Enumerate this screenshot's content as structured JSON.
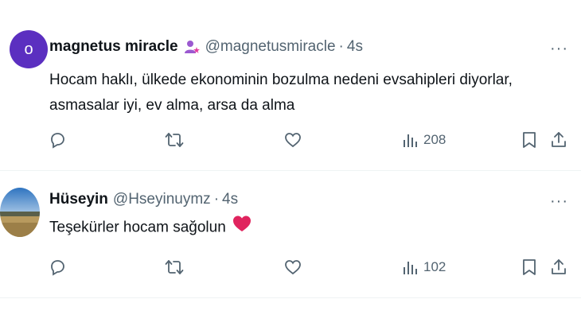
{
  "tweets": [
    {
      "avatar_letter": "o",
      "name": "magnetus miracle",
      "handle": "@magnetusmiracle",
      "separator": "·",
      "time": "4s",
      "text_line1": "Hocam haklı, ülkede ekonominin bozulma nedeni evsahipleri diyorlar,",
      "text_line2": "asmasalar iyi, ev alma, arsa da alma",
      "views": "208",
      "more_label": "···"
    },
    {
      "name": "Hüseyin",
      "handle": "@Hseyinuymz",
      "separator": "·",
      "time": "4s",
      "text_line1": "Teşekürler hocam sağolun",
      "views": "102",
      "more_label": "···"
    }
  ],
  "colors": {
    "avatar_bg": "#5b2fc0",
    "icon_gray": "#536471",
    "heart_red": "#e0245e"
  },
  "icons": [
    "reply-icon",
    "retweet-icon",
    "like-icon",
    "views-icon",
    "bookmark-icon",
    "share-icon",
    "more-icon",
    "heart-emoji-icon",
    "person-sparkle-icon"
  ]
}
